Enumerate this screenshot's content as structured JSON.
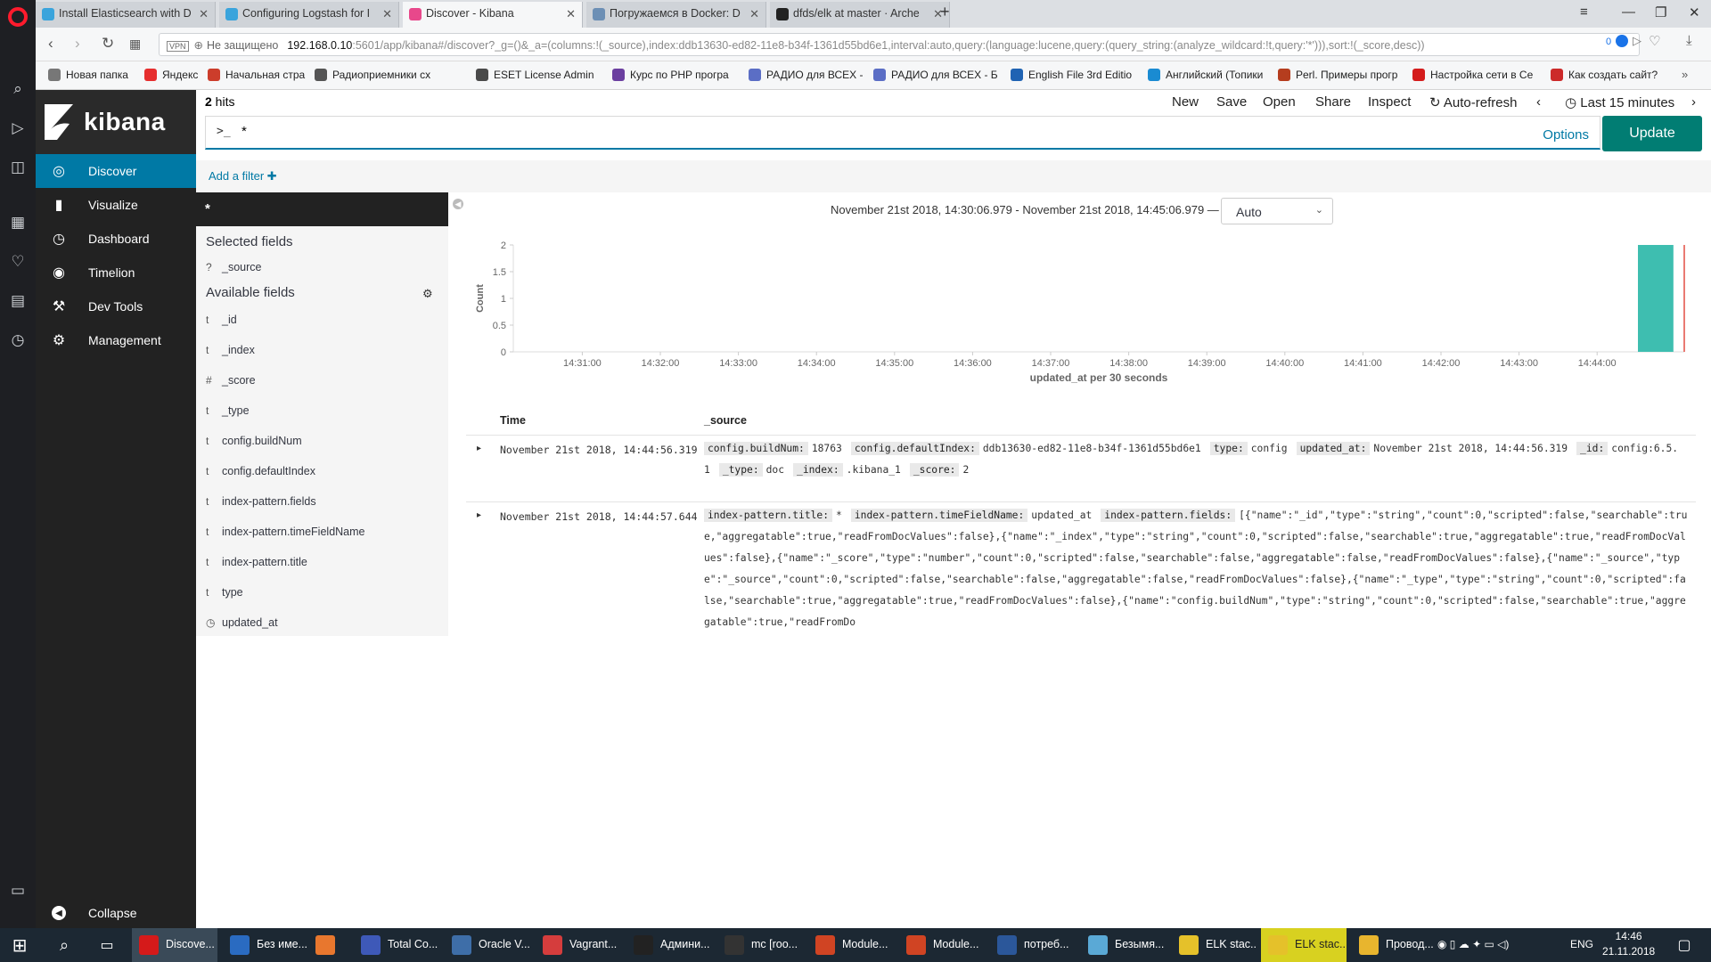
{
  "browser": {
    "tabs": [
      {
        "title": "Install Elasticsearch with D",
        "fav": "#3aa4dc"
      },
      {
        "title": "Configuring Logstash for I",
        "fav": "#3aa4dc"
      },
      {
        "title": "Discover - Kibana",
        "fav": "#e8488b"
      },
      {
        "title": "Погружаемся в Docker: D",
        "fav": "#6c8fb5"
      },
      {
        "title": "dfds/elk at master · Arche",
        "fav": "#222222"
      }
    ],
    "url_vpn": "VPN",
    "url_security": "Не защищено",
    "url_host": "192.168.0.10",
    "url_rest": ":5601/app/kibana#/discover?_g=()&_a=(columns:!(_source),index:ddb13630-ed82-11e8-b34f-1361d55bd6e1,interval:auto,query:(language:lucene,query:(query_string:(analyze_wildcard:!t,query:'*'))),sort:!(_score,desc))",
    "url_badge": "0",
    "bookmarks": [
      {
        "label": "Новая папка",
        "color": "#777777"
      },
      {
        "label": "Яндекс",
        "color": "#e62e2e"
      },
      {
        "label": "Начальная страница",
        "color": "#cc3d2b"
      },
      {
        "label": "Радиоприемники сх",
        "color": "#555555"
      },
      {
        "label": "ESET License Admin",
        "color": "#4a4a4a"
      },
      {
        "label": "Курс по PHP програ",
        "color": "#6b3fa0"
      },
      {
        "label": "РАДИО для ВСЕХ - С",
        "color": "#5b6ec5"
      },
      {
        "label": "РАДИО для ВСЕХ - Б",
        "color": "#5b6ec5"
      },
      {
        "label": "English File 3rd Editio",
        "color": "#1f63b3"
      },
      {
        "label": "Английский (Топики",
        "color": "#1a8bd2"
      },
      {
        "label": "Perl. Примеры прогр",
        "color": "#b53d1e"
      },
      {
        "label": "Настройка сети в Ce",
        "color": "#d41c1c"
      },
      {
        "label": "Как создать сайт?",
        "color": "#cc2a2a"
      }
    ]
  },
  "kibana": {
    "brand": "kibana",
    "nav": [
      {
        "label": "Discover",
        "icon": "compass-icon",
        "glyph": "◎"
      },
      {
        "label": "Visualize",
        "icon": "bar-chart-icon",
        "glyph": "▮"
      },
      {
        "label": "Dashboard",
        "icon": "dashboard-icon",
        "glyph": "◷"
      },
      {
        "label": "Timelion",
        "icon": "timelion-icon",
        "glyph": "◉"
      },
      {
        "label": "Dev Tools",
        "icon": "wrench-icon",
        "glyph": "⚒"
      },
      {
        "label": "Management",
        "icon": "gear-icon",
        "glyph": "⚙"
      }
    ],
    "collapse": "Collapse",
    "hits_count": "2",
    "hits_label": " hits",
    "top_links": [
      "New",
      "Save",
      "Open",
      "Share",
      "Inspect"
    ],
    "auto_refresh": "Auto-refresh",
    "time_label": "Last 15 minutes",
    "query_prompt": ">_",
    "query_value": "*",
    "options": "Options",
    "update": "Update",
    "add_filter": "Add a filter",
    "index_pattern": "*",
    "selected_fields_title": "Selected fields",
    "selected_fields": [
      {
        "type": "?",
        "name": "_source"
      }
    ],
    "available_fields_title": "Available fields",
    "available_fields": [
      {
        "type": "t",
        "name": "_id"
      },
      {
        "type": "t",
        "name": "_index"
      },
      {
        "type": "#",
        "name": "_score"
      },
      {
        "type": "t",
        "name": "_type"
      },
      {
        "type": "t",
        "name": "config.buildNum"
      },
      {
        "type": "t",
        "name": "config.defaultIndex"
      },
      {
        "type": "t",
        "name": "index-pattern.fields"
      },
      {
        "type": "t",
        "name": "index-pattern.timeFieldName"
      },
      {
        "type": "t",
        "name": "index-pattern.title"
      },
      {
        "type": "t",
        "name": "type"
      },
      {
        "type": "◷",
        "name": "updated_at"
      }
    ],
    "time_range": "November 21st 2018, 14:30:06.979 - November 21st 2018, 14:45:06.979 —",
    "interval": "Auto",
    "table_headers": {
      "time": "Time",
      "source": "_source"
    },
    "rows": [
      {
        "time": "November 21st 2018, 14:44:56.319",
        "fields": [
          {
            "k": "config.buildNum:",
            "v": "18763"
          },
          {
            "k": "config.defaultIndex:",
            "v": "ddb13630-ed82-11e8-b34f-1361d55bd6e1"
          },
          {
            "k": "type:",
            "v": "config"
          },
          {
            "k": "updated_at:",
            "v": "November 21st 2018, 14:44:56.319"
          },
          {
            "k": "_id:",
            "v": "config:6.5.1"
          },
          {
            "k": "_type:",
            "v": "doc"
          },
          {
            "k": "_index:",
            "v": ".kibana_1"
          },
          {
            "k": "_score:",
            "v": "2"
          }
        ]
      },
      {
        "time": "November 21st 2018, 14:44:57.644",
        "fields": [
          {
            "k": "index-pattern.title:",
            "v": "*"
          },
          {
            "k": "index-pattern.timeFieldName:",
            "v": "updated_at"
          },
          {
            "k": "index-pattern.fields:",
            "v": "[{\"name\":\"_id\",\"type\":\"string\",\"count\":0,\"scripted\":false,\"searchable\":true,\"aggregatable\":true,\"readFromDocValues\":false},{\"name\":\"_index\",\"type\":\"string\",\"count\":0,\"scripted\":false,\"searchable\":true,\"aggregatable\":true,\"readFromDocValues\":false},{\"name\":\"_score\",\"type\":\"number\",\"count\":0,\"scripted\":false,\"searchable\":false,\"aggregatable\":false,\"readFromDocValues\":false},{\"name\":\"_source\",\"type\":\"_source\",\"count\":0,\"scripted\":false,\"searchable\":false,\"aggregatable\":false,\"readFromDocValues\":false},{\"name\":\"_type\",\"type\":\"string\",\"count\":0,\"scripted\":false,\"searchable\":true,\"aggregatable\":true,\"readFromDocValues\":false},{\"name\":\"config.buildNum\",\"type\":\"string\",\"count\":0,\"scripted\":false,\"searchable\":true,\"aggregatable\":true,\"readFromDo"
          }
        ]
      }
    ]
  },
  "chart_data": {
    "type": "bar",
    "ylabel": "Count",
    "xlabel": "updated_at per 30 seconds",
    "ylim": [
      0,
      2
    ],
    "yticks": [
      "0",
      "0.5",
      "1",
      "1.5",
      "2"
    ],
    "xticks": [
      "14:31:00",
      "14:32:00",
      "14:33:00",
      "14:34:00",
      "14:35:00",
      "14:36:00",
      "14:37:00",
      "14:38:00",
      "14:39:00",
      "14:40:00",
      "14:41:00",
      "14:42:00",
      "14:43:00",
      "14:44:00"
    ],
    "x_start": "14:30:06.979",
    "x_end": "14:45:06.979",
    "bars": [
      {
        "start": "14:44:30",
        "end": "14:45:00",
        "value": 2
      }
    ],
    "now_marker": "14:45:06.979",
    "bar_color": "#3ebeb0",
    "marker_color": "#e24d42"
  },
  "taskbar": {
    "apps": [
      {
        "label": "Discove...",
        "color": "#d51a1a",
        "state": "active"
      },
      {
        "label": "Без име...",
        "color": "#2a6bc1",
        "state": ""
      },
      {
        "label": "",
        "color": "#e8772e",
        "state": ""
      },
      {
        "label": "Total Co...",
        "color": "#3e59b8",
        "state": ""
      },
      {
        "label": "Oracle V...",
        "color": "#3e6ea8",
        "state": ""
      },
      {
        "label": "Vagrant...",
        "color": "#d53d3d",
        "state": ""
      },
      {
        "label": "Админи...",
        "color": "#222222",
        "state": ""
      },
      {
        "label": "mc [roo...",
        "color": "#333333",
        "state": ""
      },
      {
        "label": "Module...",
        "color": "#d04423",
        "state": ""
      },
      {
        "label": "Module...",
        "color": "#d04423",
        "state": ""
      },
      {
        "label": "потреб...",
        "color": "#2b579a",
        "state": ""
      },
      {
        "label": "Безымя...",
        "color": "#5aa9d6",
        "state": ""
      },
      {
        "label": "ELK stac...",
        "color": "#e5c12a",
        "state": ""
      },
      {
        "label": "ELK stac...",
        "color": "#e5c12a",
        "state": "hl"
      },
      {
        "label": "Провод...",
        "color": "#e8b52e",
        "state": ""
      }
    ],
    "lang": "ENG",
    "time": "14:46",
    "date": "21.11.2018"
  }
}
